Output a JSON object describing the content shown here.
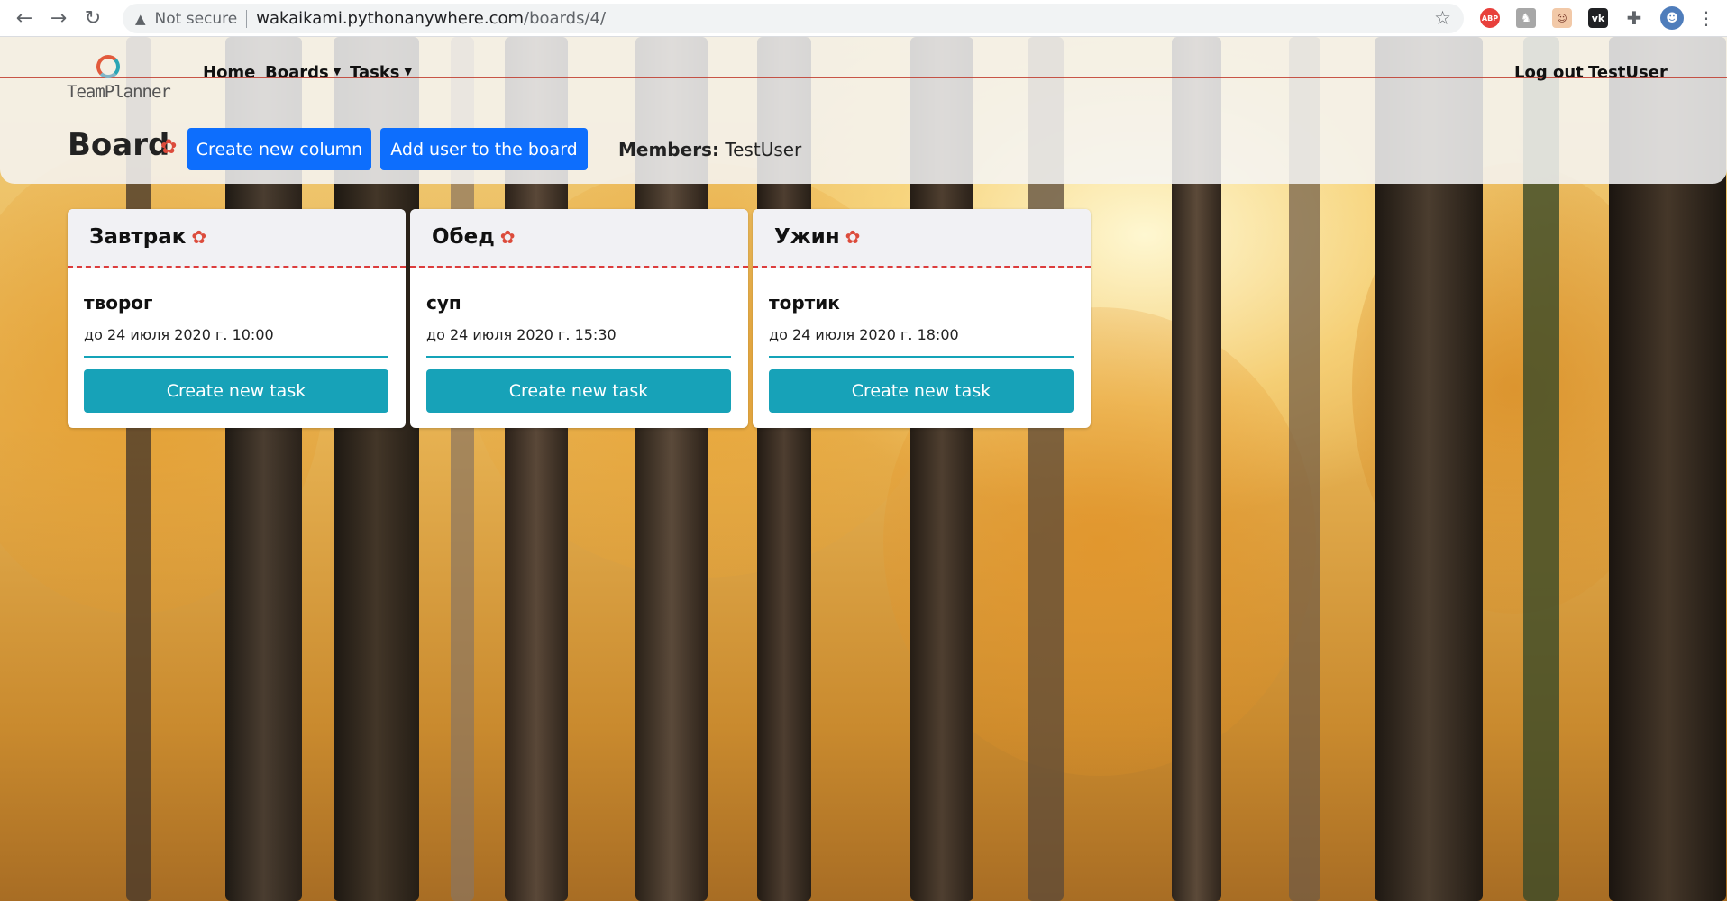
{
  "browser": {
    "security_label": "Not secure",
    "url_host": "wakaikami.pythonanywhere.com",
    "url_path": "/boards/4/",
    "extensions": [
      "abp-icon",
      "hh-icon",
      "face-icon",
      "vk-icon",
      "puzzle-icon",
      "profile-avatar-icon"
    ],
    "abp_label": "ABP",
    "vk_label": "vk"
  },
  "site": {
    "logo_text": "TeamPlanner",
    "nav": {
      "home": "Home",
      "boards": "Boards",
      "tasks": "Tasks",
      "logout": "Log out",
      "user": "TestUser"
    },
    "accent_color": "#dc3c3c",
    "primary_color": "#0d6efd",
    "info_color": "#17a2b8"
  },
  "board": {
    "title": "Board",
    "create_column_label": "Create new column",
    "add_user_label": "Add user to the board",
    "members_label": "Members:",
    "members_value": "TestUser"
  },
  "columns": [
    {
      "title": "Завтрак",
      "task_title": "творог",
      "task_due": "до 24 июля 2020 г. 10:00",
      "button": "Create new task"
    },
    {
      "title": "Обед",
      "task_title": "суп",
      "task_due": "до 24 июля 2020 г. 15:30",
      "button": "Create new task"
    },
    {
      "title": "Ужин",
      "task_title": "тортик",
      "task_due": "до 24 июля 2020 г. 18:00",
      "button": "Create new task"
    }
  ]
}
